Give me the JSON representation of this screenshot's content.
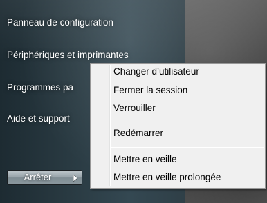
{
  "start_menu": {
    "items": [
      {
        "label": "Panneau de configuration"
      },
      {
        "label": "Périphériques et imprimantes"
      },
      {
        "label": "Programmes pa"
      },
      {
        "label": "Aide et support"
      }
    ],
    "shutdown": {
      "label": "Arrêter",
      "arrow_icon": "triangle-right-icon"
    }
  },
  "context_menu": {
    "items": [
      {
        "label": "Changer d’utilisateur"
      },
      {
        "label": "Fermer la session"
      },
      {
        "label": "Verrouiller"
      },
      {
        "label": "Redémarrer"
      },
      {
        "label": "Mettre en veille"
      },
      {
        "label": "Mettre en veille prolongée"
      }
    ]
  }
}
